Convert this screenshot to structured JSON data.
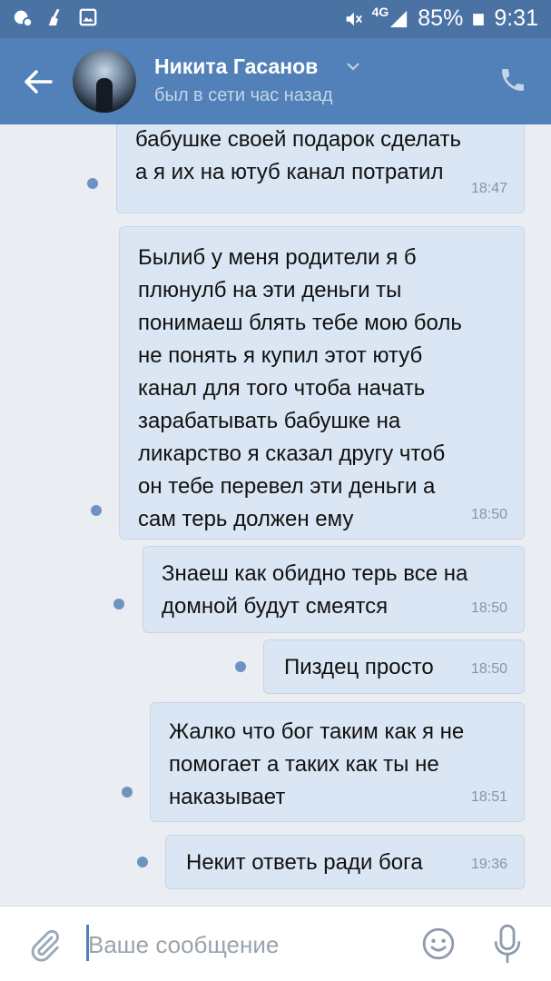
{
  "status_bar": {
    "network_label": "4G",
    "battery": "85%",
    "time": "9:31",
    "icons": [
      "messenger-icon",
      "cleaner-icon",
      "gallery-icon",
      "mute-icon",
      "signal-icon",
      "battery-icon"
    ]
  },
  "header": {
    "name": "Никита Гасанов",
    "status": "был в сети час назад",
    "icons": [
      "back-arrow-icon",
      "chevron-down-icon",
      "phone-icon"
    ]
  },
  "messages": [
    {
      "text": "бабушке своей подарок сделать\nа я их на ютуб канал потратил",
      "time": "18:47"
    },
    {
      "text": "Былиб у меня родители я б\nплюнулб на эти деньги ты\nпонимаеш блять тебе мою боль\nне понять я купил этот ютуб\nканал для того чтоба начать\nзарабатывать бабушке на\nликарство я сказал другу чтоб\nон тебе перевел эти деньги а\nсам терь должен ему",
      "time": "18:50"
    },
    {
      "text": "Знаеш как обидно терь все на\nдомной будут смеятся",
      "time": "18:50"
    },
    {
      "text": "Пиздец просто",
      "time": "18:50"
    },
    {
      "text": "Жалко что бог таким как я не\nпомогает а таких как ты не\nнаказывает",
      "time": "18:51"
    },
    {
      "text": "Некит ответь ради бога",
      "time": "19:36"
    }
  ],
  "composer": {
    "placeholder": "Ваше сообщение",
    "icons": [
      "attach-icon",
      "emoji-icon",
      "microphone-icon"
    ]
  },
  "colors": {
    "header": "#5181b8",
    "status_bar": "#4a72a3",
    "bubble": "#dbe6f4",
    "background": "#eaeef3",
    "unread_dot": "#6e93c2"
  }
}
